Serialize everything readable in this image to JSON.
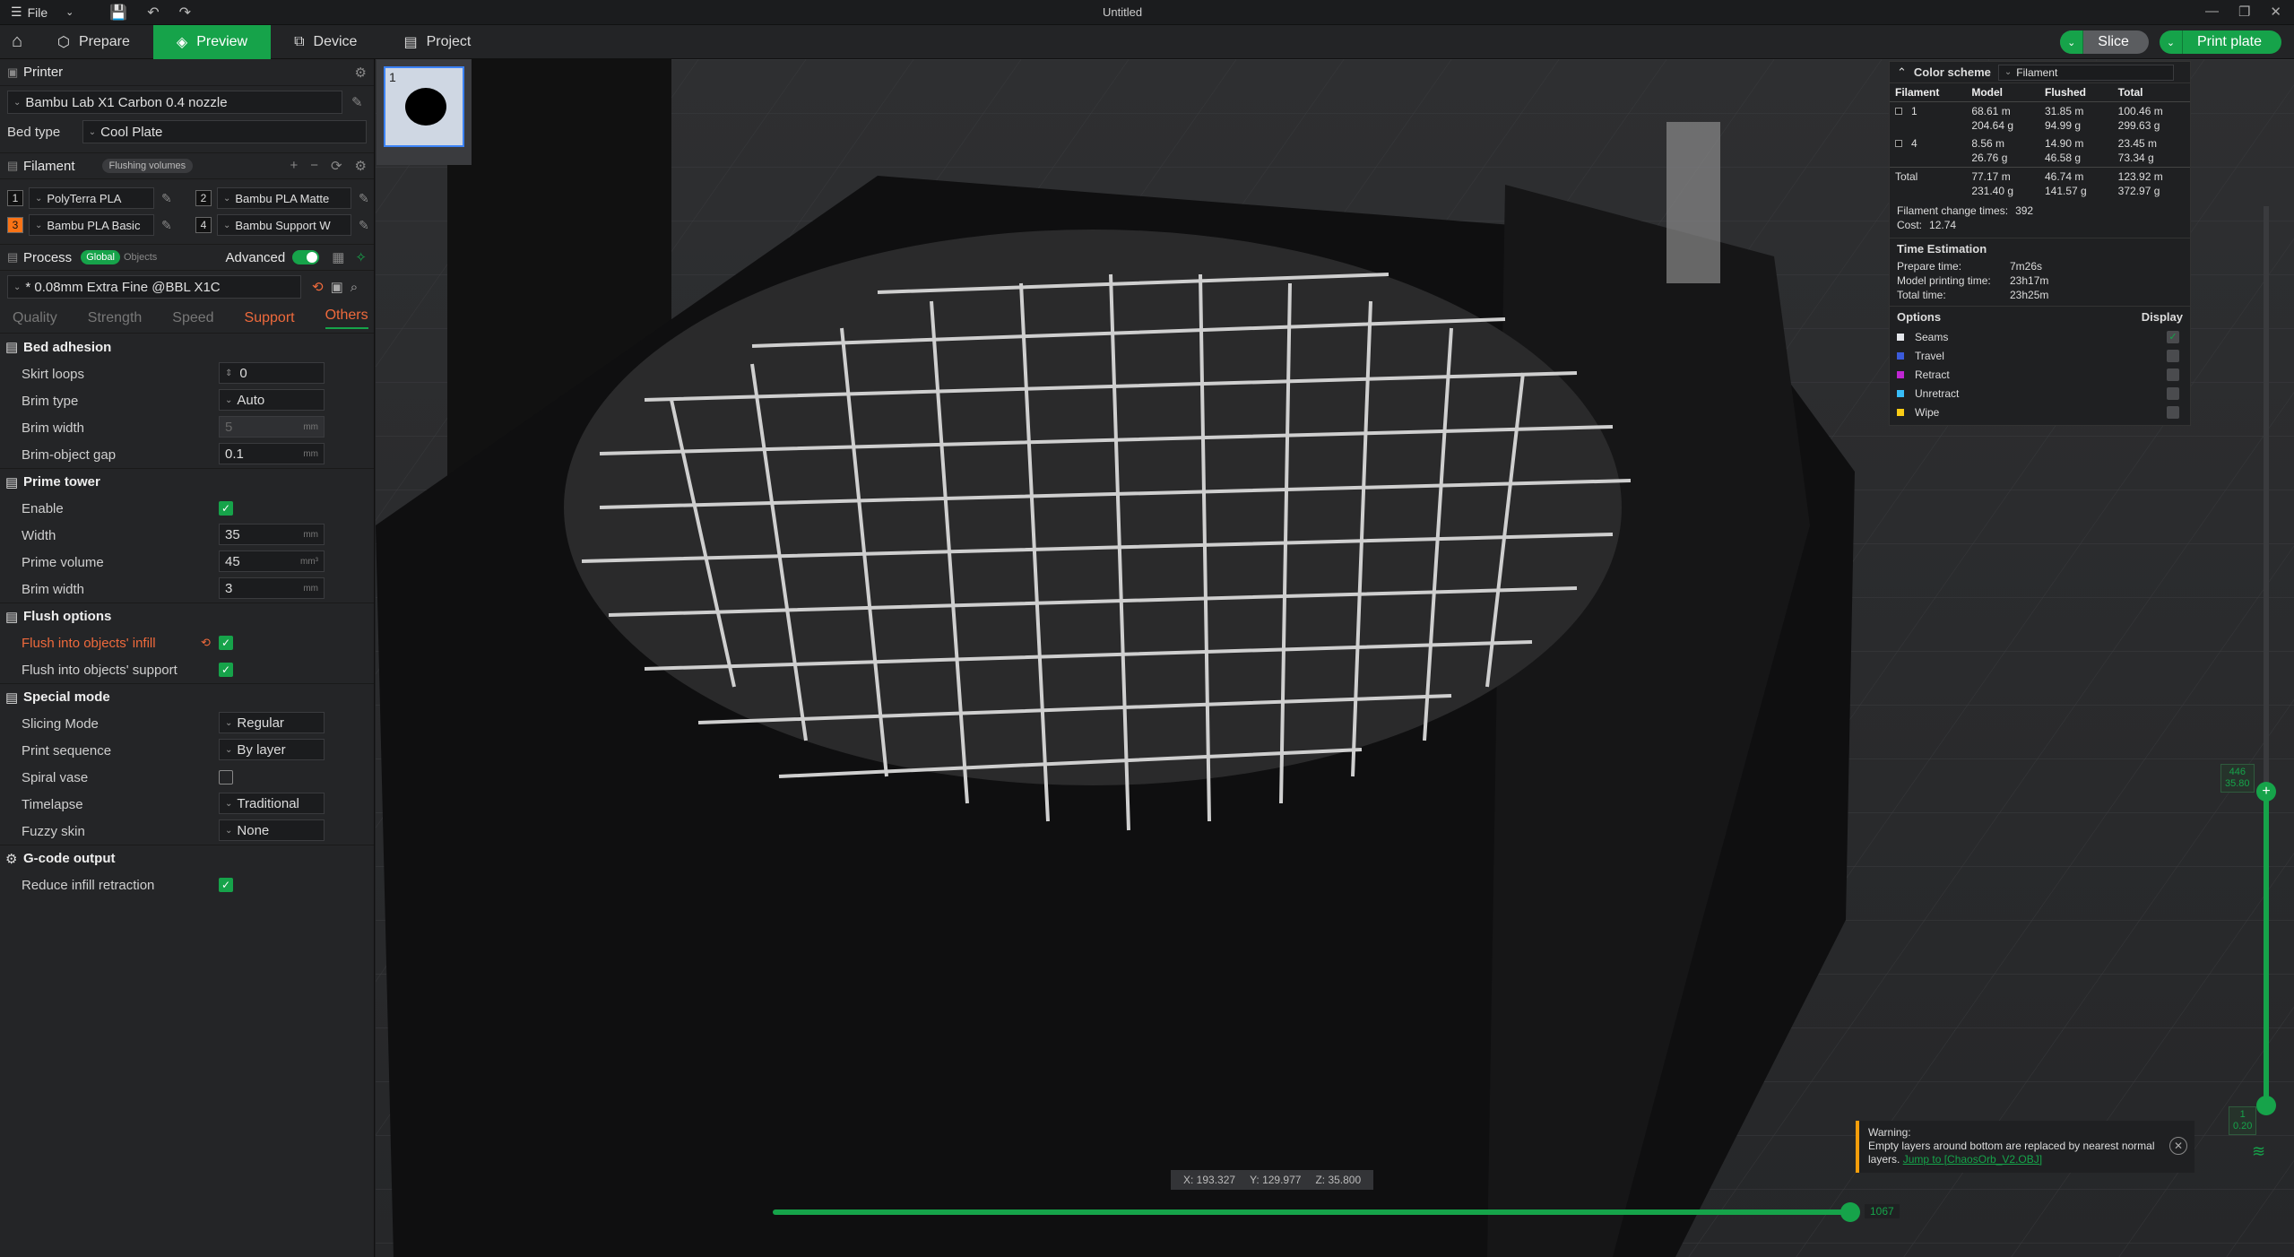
{
  "titlebar": {
    "file_label": "File",
    "title": "Untitled"
  },
  "tabs": [
    {
      "label": "Prepare"
    },
    {
      "label": "Preview"
    },
    {
      "label": "Device"
    },
    {
      "label": "Project"
    }
  ],
  "buttons": {
    "slice": "Slice",
    "print": "Print plate"
  },
  "printer": {
    "section": "Printer",
    "name": "Bambu Lab X1 Carbon 0.4 nozzle",
    "bed_label": "Bed type",
    "bed": "Cool Plate"
  },
  "filament": {
    "section": "Filament",
    "flushing": "Flushing volumes",
    "items": [
      {
        "num": "1",
        "name": "PolyTerra PLA",
        "color": "#111111"
      },
      {
        "num": "2",
        "name": "Bambu PLA Matte",
        "color": "#111111"
      },
      {
        "num": "3",
        "name": "Bambu PLA Basic",
        "color": "#f97316"
      },
      {
        "num": "4",
        "name": "Bambu Support W",
        "color": "#111111"
      }
    ]
  },
  "process": {
    "section": "Process",
    "global": "Global",
    "objects": "Objects",
    "advanced": "Advanced",
    "profile": "* 0.08mm Extra Fine @BBL X1C",
    "tabs": [
      "Quality",
      "Strength",
      "Speed",
      "Support",
      "Others"
    ]
  },
  "bed_adhesion": {
    "title": "Bed adhesion",
    "skirt_loops": "Skirt loops",
    "skirt_val": "0",
    "brim_type": "Brim type",
    "brim_type_val": "Auto",
    "brim_width": "Brim width",
    "brim_width_val": "5",
    "brim_gap": "Brim-object gap",
    "brim_gap_val": "0.1",
    "unit_mm": "mm"
  },
  "prime_tower": {
    "title": "Prime tower",
    "enable": "Enable",
    "width": "Width",
    "width_val": "35",
    "volume": "Prime volume",
    "volume_val": "45",
    "volume_unit": "mm³",
    "brim": "Brim width",
    "brim_val": "3"
  },
  "flush": {
    "title": "Flush options",
    "infill": "Flush into objects' infill",
    "support": "Flush into objects' support"
  },
  "special": {
    "title": "Special mode",
    "slicing": "Slicing Mode",
    "slicing_val": "Regular",
    "sequence": "Print sequence",
    "sequence_val": "By layer",
    "spiral": "Spiral vase",
    "timelapse": "Timelapse",
    "timelapse_val": "Traditional",
    "fuzzy": "Fuzzy skin",
    "fuzzy_val": "None"
  },
  "gcode": {
    "title": "G-code output",
    "reduce": "Reduce infill retraction"
  },
  "plate": {
    "num": "1"
  },
  "stats": {
    "scheme_label": "Color scheme",
    "scheme": "Filament",
    "cols": [
      "Filament",
      "Model",
      "Flushed",
      "Total"
    ],
    "rows": [
      {
        "id": "1",
        "model": "68.61 m",
        "model2": "204.64 g",
        "flushed": "31.85 m",
        "flushed2": "94.99 g",
        "total": "100.46 m",
        "total2": "299.63 g"
      },
      {
        "id": "4",
        "model": "8.56 m",
        "model2": "26.76 g",
        "flushed": "14.90 m",
        "flushed2": "46.58 g",
        "total": "23.45 m",
        "total2": "73.34 g"
      }
    ],
    "sum": {
      "label": "Total",
      "model": "77.17 m",
      "model2": "231.40 g",
      "flushed": "46.74 m",
      "flushed2": "141.57 g",
      "total": "123.92 m",
      "total2": "372.97 g"
    },
    "change": "Filament change times:",
    "change_val": "392",
    "cost": "Cost:",
    "cost_val": "12.74",
    "time_title": "Time Estimation",
    "prep": "Prepare time:",
    "prep_val": "7m26s",
    "model_t": "Model printing time:",
    "model_t_val": "23h17m",
    "total_t": "Total time:",
    "total_t_val": "23h25m",
    "options": "Options",
    "display": "Display",
    "opts": [
      {
        "name": "Seams",
        "color": "#e5e7eb"
      },
      {
        "name": "Travel",
        "color": "#3b5bdb"
      },
      {
        "name": "Retract",
        "color": "#c026d3"
      },
      {
        "name": "Unretract",
        "color": "#38bdf8"
      },
      {
        "name": "Wipe",
        "color": "#facc15"
      }
    ]
  },
  "sliders": {
    "h_val": "1067",
    "v_top": "446",
    "v_top2": "35.80",
    "v_bot": "1",
    "v_bot2": "0.20"
  },
  "coords": {
    "x": "X: 193.327",
    "y": "Y: 129.977",
    "z": "Z: 35.800"
  },
  "warning": {
    "title": "Warning:",
    "text": "Empty layers around bottom are replaced by nearest normal layers.",
    "link": "Jump to [ChaosOrb_V2.OBJ]"
  }
}
